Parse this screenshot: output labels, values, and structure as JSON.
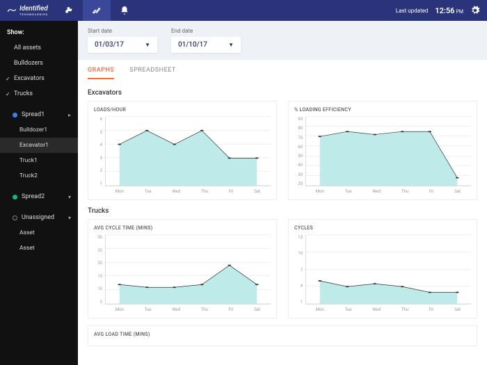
{
  "brand": "Identified",
  "brand_sub": "TECHNOLOGIES",
  "last_updated_label": "Last updated",
  "time": "12:56",
  "time_suffix": "PM",
  "sidebar": {
    "show_label": "Show:",
    "filters": [
      {
        "label": "All assets",
        "sel": false
      },
      {
        "label": "Bulldozers",
        "sel": false
      },
      {
        "label": "Excavators",
        "sel": true
      },
      {
        "label": "Trucks",
        "sel": true
      }
    ],
    "groups": [
      {
        "label": "Spread1",
        "color": "blue",
        "expanded": true,
        "items": [
          "Bulldozer1",
          "Excavator1",
          "Truck1",
          "Truck2"
        ],
        "activeIndex": 1
      },
      {
        "label": "Spread2",
        "color": "green",
        "expanded": false,
        "items": []
      },
      {
        "label": "Unassigned",
        "color": "hollow",
        "expanded": false,
        "items": [
          "Asset",
          "Asset"
        ]
      }
    ]
  },
  "filters": {
    "start_label": "Start date",
    "start_value": "01/03/17",
    "end_label": "End date",
    "end_value": "01/10/17"
  },
  "tabs": [
    {
      "label": "GRAPHS",
      "active": true
    },
    {
      "label": "SPREADSHEET",
      "active": false
    }
  ],
  "sections": {
    "excavators": "Excavators",
    "trucks": "Trucks"
  },
  "chart_data": [
    {
      "id": "loads",
      "type": "area",
      "title": "LOADS/HOUR",
      "categories": [
        "Mon",
        "Tue",
        "Wed",
        "Thu",
        "Fri",
        "Sat"
      ],
      "values": [
        4,
        5,
        4,
        5,
        3,
        3
      ],
      "ylim": [
        1,
        6
      ],
      "yticks": [
        1,
        2,
        3,
        4,
        5,
        6
      ]
    },
    {
      "id": "eff",
      "type": "area",
      "title": "% LOADING EFFICIENCY",
      "categories": [
        "Mon",
        "Tue",
        "Wed",
        "Thu",
        "Fri",
        "Sat"
      ],
      "values": [
        70,
        75,
        72,
        75,
        75,
        28
      ],
      "ylim": [
        20,
        90
      ],
      "yticks": [
        20,
        30,
        40,
        50,
        60,
        70,
        80,
        90
      ]
    },
    {
      "id": "cycle",
      "type": "area",
      "title": "AVG CYCLE TIME (MINS)",
      "categories": [
        "Mon",
        "Tue",
        "Wed",
        "Thu",
        "Fri",
        "Sat"
      ],
      "values": [
        12,
        11,
        11,
        12,
        19,
        12
      ],
      "ylim": [
        5,
        30
      ],
      "yticks": [
        5,
        10,
        15,
        20,
        25,
        30
      ]
    },
    {
      "id": "cycles",
      "type": "area",
      "title": "CYCLES",
      "categories": [
        "Mon",
        "Tue",
        "Wed",
        "Thu",
        "Fri",
        "Sat"
      ],
      "values": [
        5,
        4,
        4.5,
        4,
        3,
        3
      ],
      "ylim": [
        1,
        13
      ],
      "yticks": [
        1,
        4,
        7,
        10,
        13
      ]
    }
  ],
  "extra_chart_title": "AVG LOAD TIME (MINS)"
}
